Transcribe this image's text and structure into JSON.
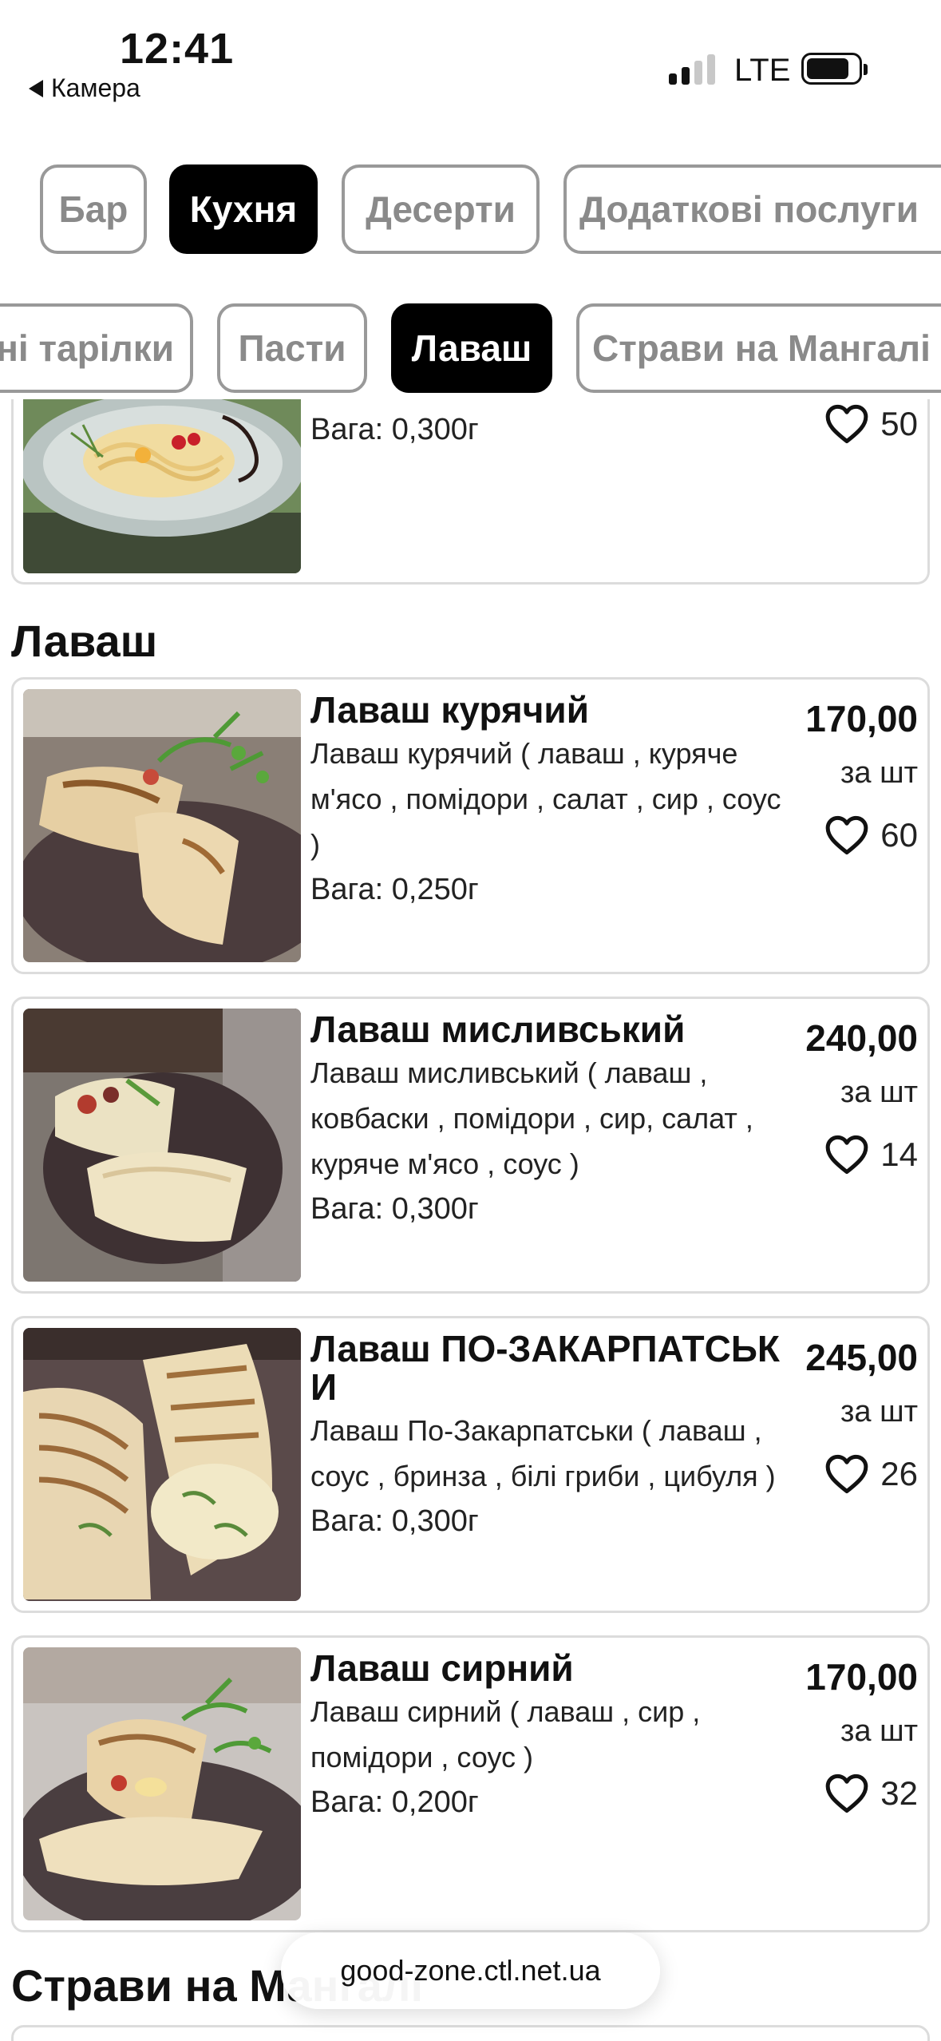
{
  "status_bar": {
    "time": "12:41",
    "back_label": "Камера",
    "network": "LTE"
  },
  "top_categories": [
    {
      "label": "Бар",
      "active": false
    },
    {
      "label": "Кухня",
      "active": true
    },
    {
      "label": "Десерти",
      "active": false
    },
    {
      "label": "Додаткові послуги",
      "active": false
    }
  ],
  "sub_categories": [
    {
      "label": "ні тарілки",
      "active": false
    },
    {
      "label": "Пасти",
      "active": false
    },
    {
      "label": "Лаваш",
      "active": true
    },
    {
      "label": "Страви на Мангалі",
      "active": false
    }
  ],
  "previous_item": {
    "weight": "Вага: 0,300г",
    "likes": "50"
  },
  "section": {
    "title": "Лаваш"
  },
  "items": [
    {
      "title": "Лаваш курячий",
      "description": "Лаваш курячий ( лаваш , куряче м'ясо , помідори , салат , сир , соус )",
      "weight": "Вага: 0,250г",
      "price": "170,00",
      "unit": "за шт",
      "likes": "60"
    },
    {
      "title": "Лаваш мисливський",
      "description": "Лаваш мисливський ( лаваш , ковбаски , помідори , сир, салат , куряче м'ясо , соус )",
      "weight": "Вага: 0,300г",
      "price": "240,00",
      "unit": "за шт",
      "likes": "14"
    },
    {
      "title": "Лаваш ПО-ЗАКАРПАТСЬКИ",
      "description": "Лаваш По-Закарпатськи ( лаваш , соус , бринза , білі гриби , цибуля )",
      "weight": "Вага: 0,300г",
      "price": "245,00",
      "unit": "за шт",
      "likes": "26"
    },
    {
      "title": "Лаваш сирний",
      "description": "Лаваш сирний ( лаваш , сир , помідори , соус )",
      "weight": "Вага: 0,200г",
      "price": "170,00",
      "unit": "за шт",
      "likes": "32"
    }
  ],
  "next_section": {
    "title": "Страви на Мангалі"
  },
  "browser": {
    "url": "good-zone.ctl.net.ua"
  },
  "colors": {
    "active_chip": "#000000",
    "inactive_chip_border": "#999999",
    "card_border": "#dcdcdc"
  }
}
